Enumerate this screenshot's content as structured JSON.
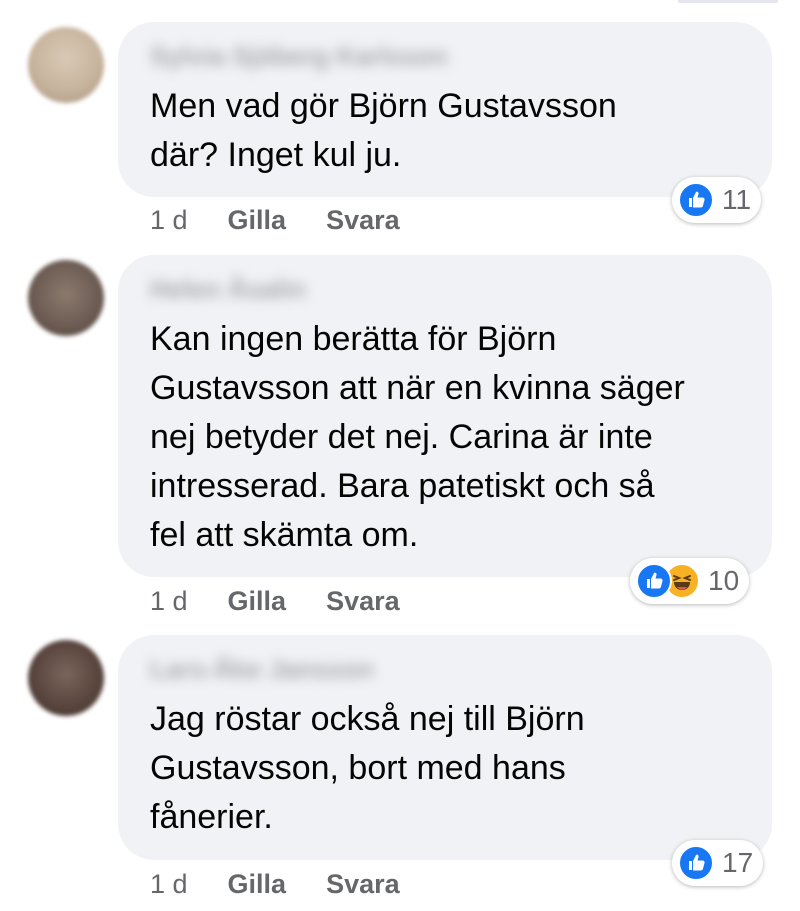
{
  "comments": [
    {
      "author": "Sylvia Sjöberg Karlsson",
      "text": "Men vad gör Björn Gustavsson\ndär? Inget kul ju.",
      "time": "1 d",
      "like": "Gilla",
      "reply": "Svara",
      "reaction_count": "11",
      "reactions": [
        "like"
      ],
      "avatar_color": "#cdbba4"
    },
    {
      "author": "Helen Åsalin",
      "text": "Kan ingen berätta för Björn\nGustavsson att när en kvinna säger\nnej betyder det nej. Carina är inte\nintresserad. Bara patetiskt och så\nfel att skämta om.",
      "time": "1 d",
      "like": "Gilla",
      "reply": "Svara",
      "reaction_count": "10",
      "reactions": [
        "like",
        "haha"
      ],
      "avatar_color": "#7b6a60"
    },
    {
      "author": "Lars-Åke Jansson",
      "text": "Jag röstar också nej till Björn\nGustavsson, bort med hans\nfånerier.",
      "time": "1 d",
      "like": "Gilla",
      "reply": "Svara",
      "reaction_count": "17",
      "reactions": [
        "like"
      ],
      "avatar_color": "#5e4a43"
    }
  ],
  "colors": {
    "bubble": "#f0f2f5",
    "like": "#1877f2",
    "haha": "#f7b125",
    "secondary_text": "#65676b"
  }
}
